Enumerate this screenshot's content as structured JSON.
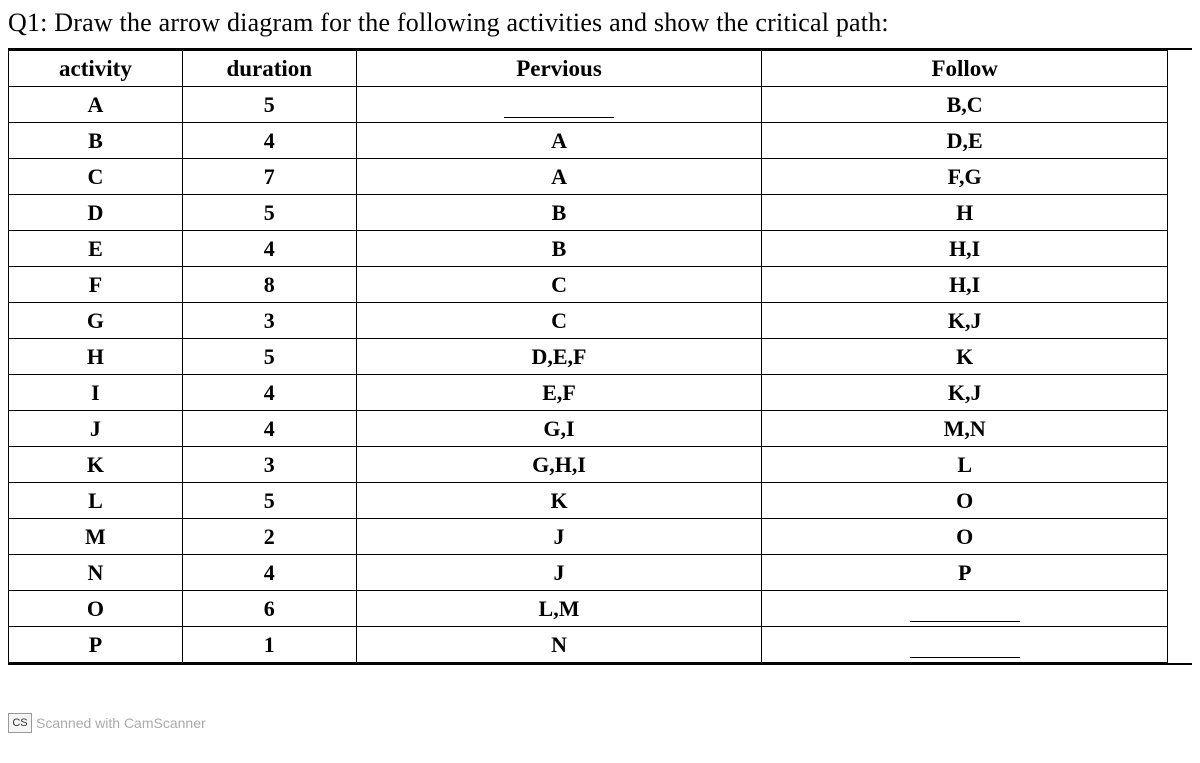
{
  "question": "Q1: Draw the arrow diagram for the following activities and show the critical path:",
  "headers": {
    "activity": "activity",
    "duration": "duration",
    "pervious": "Pervious",
    "follow": "Follow"
  },
  "rows": [
    {
      "activity": "A",
      "duration": "5",
      "pervious": "",
      "follow": "B,C"
    },
    {
      "activity": "B",
      "duration": "4",
      "pervious": "A",
      "follow": "D,E"
    },
    {
      "activity": "C",
      "duration": "7",
      "pervious": "A",
      "follow": "F,G"
    },
    {
      "activity": "D",
      "duration": "5",
      "pervious": "B",
      "follow": "H"
    },
    {
      "activity": "E",
      "duration": "4",
      "pervious": "B",
      "follow": "H,I"
    },
    {
      "activity": "F",
      "duration": "8",
      "pervious": "C",
      "follow": "H,I"
    },
    {
      "activity": "G",
      "duration": "3",
      "pervious": "C",
      "follow": "K,J"
    },
    {
      "activity": "H",
      "duration": "5",
      "pervious": "D,E,F",
      "follow": "K"
    },
    {
      "activity": "I",
      "duration": "4",
      "pervious": "E,F",
      "follow": "K,J"
    },
    {
      "activity": "J",
      "duration": "4",
      "pervious": "G,I",
      "follow": "M,N"
    },
    {
      "activity": "K",
      "duration": "3",
      "pervious": "G,H,I",
      "follow": "L"
    },
    {
      "activity": "L",
      "duration": "5",
      "pervious": "K",
      "follow": "O"
    },
    {
      "activity": "M",
      "duration": "2",
      "pervious": "J",
      "follow": "O"
    },
    {
      "activity": "N",
      "duration": "4",
      "pervious": "J",
      "follow": "P"
    },
    {
      "activity": "O",
      "duration": "6",
      "pervious": "L,M",
      "follow": ""
    },
    {
      "activity": "P",
      "duration": "1",
      "pervious": "N",
      "follow": ""
    }
  ],
  "watermark": {
    "prefix": "CS",
    "text": "Scanned with CamScanner"
  }
}
